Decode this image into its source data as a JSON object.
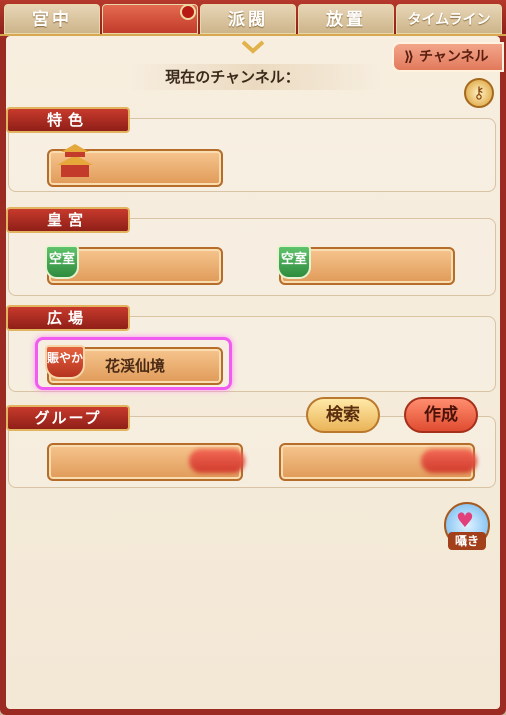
{
  "tabs": [
    {
      "label": "宮中"
    },
    {
      "label": "派閥"
    },
    {
      "label": "放置"
    },
    {
      "label": "タイムライン"
    }
  ],
  "channel_button": "チャンネル",
  "current_channel_label": "現在のチャンネル：",
  "sections": {
    "feature": {
      "title": "特色"
    },
    "imperial": {
      "title": "皇宮",
      "badge": "空室"
    },
    "plaza": {
      "title": "広場",
      "badge": "賑やか",
      "room": "花渓仙境"
    },
    "group": {
      "title": "グループ",
      "search": "検索",
      "create": "作成"
    }
  },
  "whisper_label": "囁き",
  "colors": {
    "accent_red": "#9b2a22",
    "highlight": "#f05cf0",
    "badge_green": "#3fa350"
  }
}
